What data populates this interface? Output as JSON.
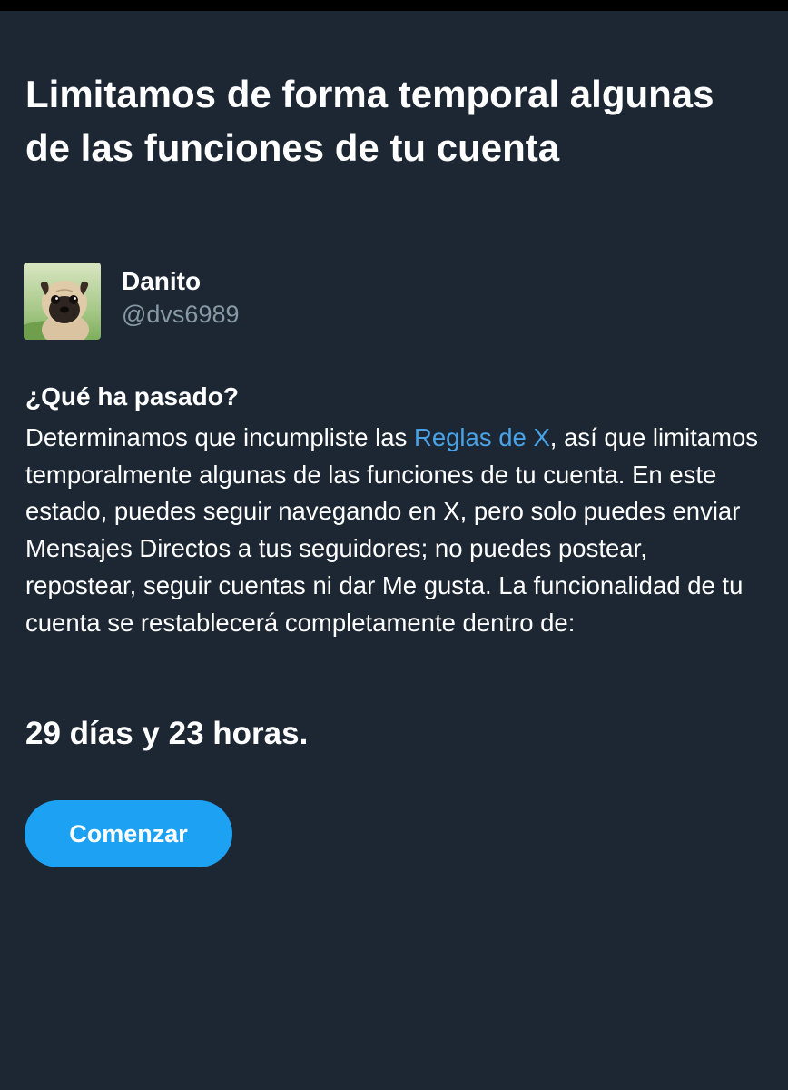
{
  "header": {
    "title": "Limitamos de forma temporal algunas de las funciones de tu cuenta"
  },
  "profile": {
    "display_name": "Danito",
    "handle": "@dvs6989",
    "avatar_icon": "pug-avatar-image"
  },
  "notice": {
    "heading": "¿Qué ha pasado?",
    "body_before_link": "Determinamos que incumpliste las ",
    "link_text": "Reglas de X",
    "body_after_link": ", así que limitamos temporalmente algunas de las funciones de tu cuenta. En este estado, puedes seguir navegando en X, pero solo puedes enviar Mensajes Directos a tus seguidores; no puedes postear, repostear, seguir cuentas ni dar Me gusta. La funcionalidad de tu cuenta se restablecerá completamente dentro de:",
    "remaining_time": "29 días y 23 horas."
  },
  "actions": {
    "start_label": "Comenzar"
  },
  "colors": {
    "background": "#1c2733",
    "accent": "#1da1f2",
    "link": "#4aa3e6",
    "secondary_text": "#8899a6"
  }
}
